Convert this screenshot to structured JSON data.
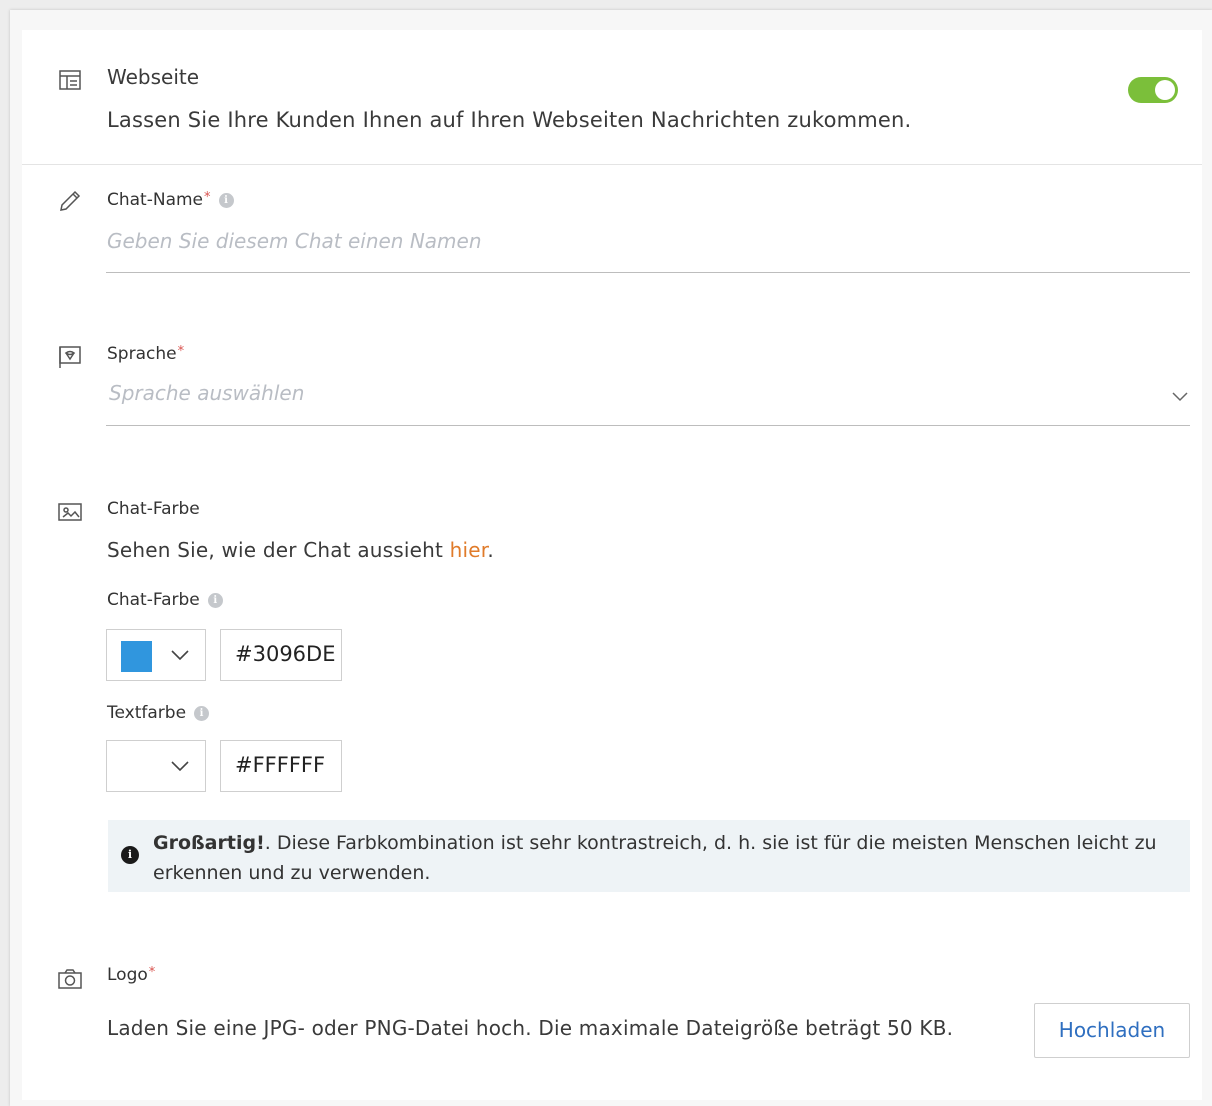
{
  "website": {
    "title": "Webseite",
    "description": "Lassen Sie Ihre Kunden Ihnen auf Ihren Webseiten Nachrichten zukommen.",
    "enabled": true,
    "toggle_color": "#7bbf3a"
  },
  "chat_name": {
    "label": "Chat-Name",
    "required_mark": "*",
    "info_icon": "i",
    "placeholder": "Geben Sie diesem Chat einen Namen",
    "value": ""
  },
  "language": {
    "label": "Sprache",
    "required_mark": "*",
    "placeholder": "Sprache auswählen"
  },
  "chat_color_section": {
    "title": "Chat-Farbe",
    "description_prefix": "Sehen Sie, wie der Chat aussieht ",
    "link_text": "hier",
    "description_suffix": "."
  },
  "chat_color": {
    "label": "Chat-Farbe",
    "info_icon": "i",
    "swatch": "#3096DE",
    "value": "#3096DE"
  },
  "text_color": {
    "label": "Textfarbe",
    "info_icon": "i",
    "swatch": "#FFFFFF",
    "value": "#FFFFFF"
  },
  "contrast_notice": {
    "icon": "i",
    "bold": "Großartig!",
    "text": ". Diese Farbkombination ist sehr kontrastreich, d. h. sie ist für die meisten Menschen leicht zu erkennen und zu verwenden."
  },
  "logo": {
    "label": "Logo",
    "required_mark": "*",
    "description": "Laden Sie eine JPG- oder PNG-Datei hoch. Die maximale Dateigröße beträgt 50 KB.",
    "upload_label": "Hochladen"
  },
  "icons": {
    "website": "website-layout-icon",
    "chat_name": "pencil-icon",
    "language": "language-flag-icon",
    "chat_color": "image-palette-icon",
    "logo": "camera-icon",
    "dropdown": "chevron-down-icon"
  }
}
